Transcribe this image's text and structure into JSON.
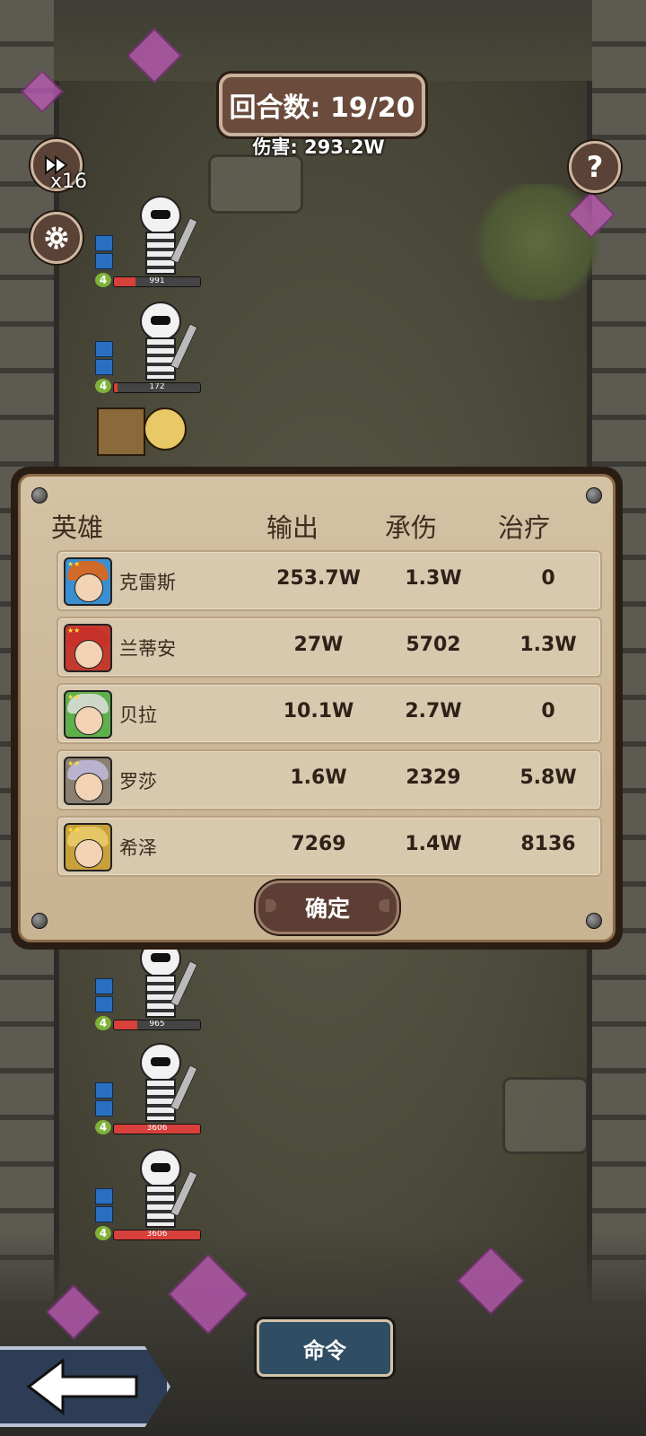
{
  "hud": {
    "round_label": "回合数: 19/20",
    "damage_label": "伤害: 293.2W",
    "speed": "x16",
    "icons": {
      "speed": "fast-forward-icon",
      "settings": "gear-icon",
      "help": "question-icon"
    }
  },
  "enemies_top": [
    {
      "level": "4",
      "hp_text": "991",
      "hp_fraction": 0.25
    },
    {
      "level": "4",
      "hp_text": "172",
      "hp_fraction": 0.04
    }
  ],
  "enemies_bottom": [
    {
      "level": "4",
      "hp_text": "965",
      "hp_fraction": 0.27
    },
    {
      "level": "4",
      "hp_text": "3606",
      "hp_fraction": 1.0
    },
    {
      "level": "4",
      "hp_text": "3606",
      "hp_fraction": 1.0
    }
  ],
  "stats": {
    "headers": {
      "hero": "英雄",
      "output": "输出",
      "taken": "承伤",
      "heal": "治疗"
    },
    "rows": [
      {
        "name": "克雷斯",
        "output": "253.7W",
        "taken": "1.3W",
        "heal": "0",
        "hair": "#d06a2a",
        "frame": "#3a8fd1"
      },
      {
        "name": "兰蒂安",
        "output": "27W",
        "taken": "5702",
        "heal": "1.3W",
        "hair": "#c8302a",
        "frame": "#c23b2d"
      },
      {
        "name": "贝拉",
        "output": "10.1W",
        "taken": "2.7W",
        "heal": "0",
        "hair": "#cfd8c8",
        "frame": "#5db04a"
      },
      {
        "name": "罗莎",
        "output": "1.6W",
        "taken": "2329",
        "heal": "5.8W",
        "hair": "#b9b3cf",
        "frame": "#8a7f70"
      },
      {
        "name": "希泽",
        "output": "7269",
        "taken": "1.4W",
        "heal": "8136",
        "hair": "#e6c766",
        "frame": "#c9a13a"
      }
    ],
    "confirm_label": "确定"
  },
  "bottom": {
    "command_label": "命令",
    "back_icon": "arrow-left-icon"
  }
}
